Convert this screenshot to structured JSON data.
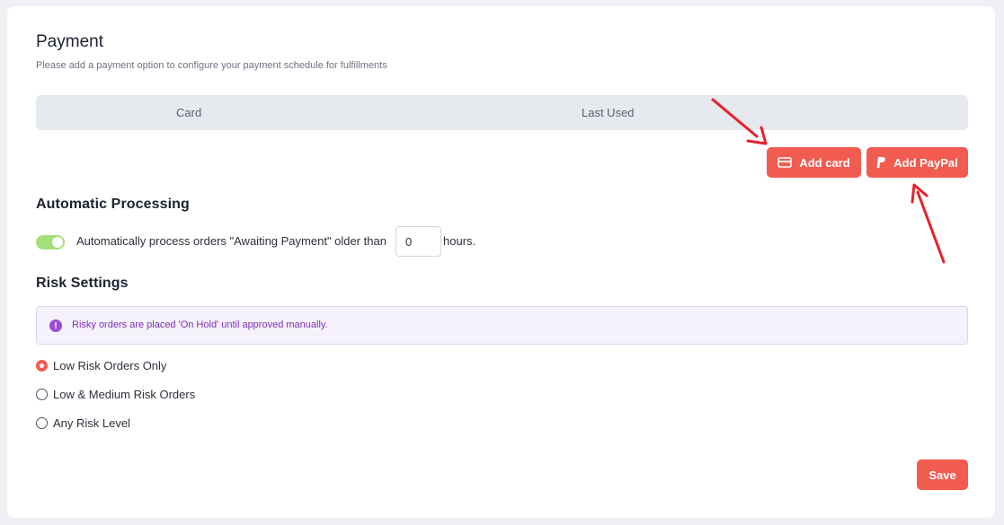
{
  "payment": {
    "title": "Payment",
    "subtitle": "Please add a payment option to configure your payment schedule for fulfillments",
    "table_headers": [
      "Card",
      "Last Used"
    ],
    "add_card_label": "Add card",
    "add_paypal_label": "Add PayPal"
  },
  "automatic_processing": {
    "title": "Automatic Processing",
    "toggle_on": true,
    "label_before": "Automatically process orders \"Awaiting Payment\" older than",
    "hours_value": "0",
    "label_after": "hours."
  },
  "risk_settings": {
    "title": "Risk Settings",
    "notice_text": "Risky orders are placed 'On Hold' until approved manually.",
    "options": [
      {
        "label": "Low Risk Orders Only",
        "checked": true
      },
      {
        "label": "Low & Medium Risk Orders",
        "checked": false
      },
      {
        "label": "Any Risk Level",
        "checked": false
      }
    ]
  },
  "save_label": "Save",
  "colors": {
    "accent": "#f25c50",
    "toggle": "#a4e07a",
    "notice_text": "#7b2fb5",
    "annotation_arrow": "#e8202a"
  }
}
